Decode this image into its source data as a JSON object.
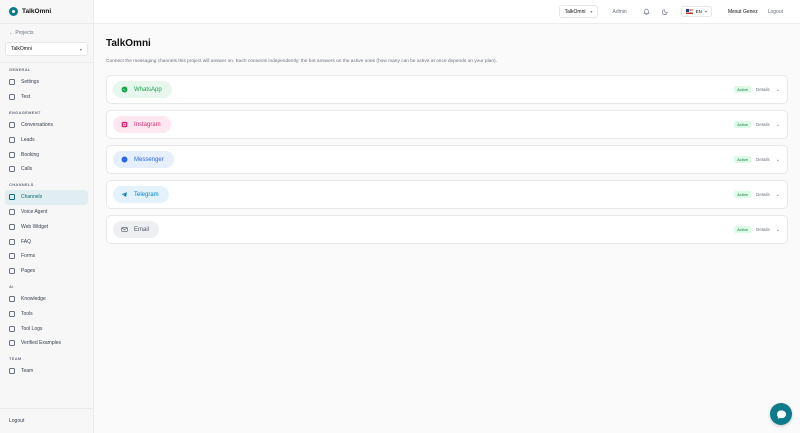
{
  "brand": {
    "name": "TalkOmni"
  },
  "sidebar": {
    "back_link": "← Projects",
    "project": "TalkOmni",
    "sections": [
      {
        "title": "GENERAL",
        "items": [
          {
            "label": "Settings"
          },
          {
            "label": "Test"
          }
        ]
      },
      {
        "title": "ENGAGEMENT",
        "items": [
          {
            "label": "Conversations"
          },
          {
            "label": "Leads"
          },
          {
            "label": "Booking"
          },
          {
            "label": "Calls"
          }
        ]
      },
      {
        "title": "CHANNELS",
        "items": [
          {
            "label": "Channels",
            "active": true
          },
          {
            "label": "Voice Agent"
          },
          {
            "label": "Web Widget"
          },
          {
            "label": "FAQ"
          },
          {
            "label": "Forms"
          },
          {
            "label": "Pages"
          }
        ]
      },
      {
        "title": "AI",
        "items": [
          {
            "label": "Knowledge"
          },
          {
            "label": "Tools"
          },
          {
            "label": "Tool Logs"
          },
          {
            "label": "Verified Examples"
          }
        ]
      },
      {
        "title": "TEAM",
        "items": [
          {
            "label": "Team"
          }
        ]
      }
    ],
    "logout": "Logout"
  },
  "topbar": {
    "project_select": "TalkOmni",
    "admin": "Admin",
    "language": "EN",
    "user_name": "Mesut Genez",
    "logout": "Logout"
  },
  "main": {
    "title": "TalkOmni",
    "description": "Connect the messaging channels this project will answer on. Each connects independently; the bot answers on the active ones (how many can be active at once depends on your plan).",
    "channels": [
      {
        "name": "WhatsApp",
        "status": "Active",
        "details": "Details",
        "color": "#16a34a",
        "bg": "#e8f7ee"
      },
      {
        "name": "Instagram",
        "status": "Active",
        "details": "Details",
        "color": "#db2777",
        "bg": "#fde7f0"
      },
      {
        "name": "Messenger",
        "status": "Active",
        "details": "Details",
        "color": "#2563eb",
        "bg": "#e6effd"
      },
      {
        "name": "Telegram",
        "status": "Active",
        "details": "Details",
        "color": "#0284c7",
        "bg": "#e4f3fb"
      },
      {
        "name": "Email",
        "status": "Active",
        "details": "Details",
        "color": "#4b5563",
        "bg": "#eeeff1"
      }
    ]
  },
  "colors": {
    "accent": "#0d7b8a",
    "active_badge": "#dcfce7"
  }
}
